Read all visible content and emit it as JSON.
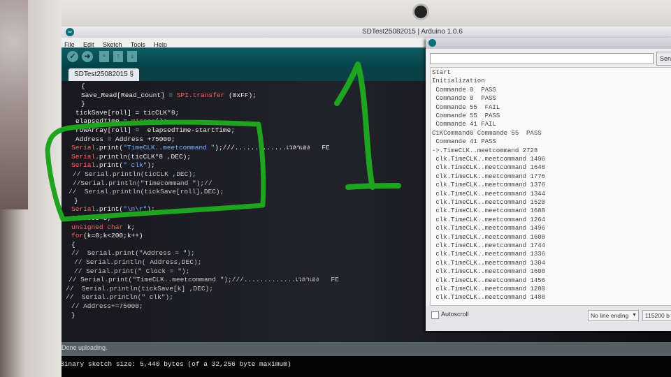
{
  "ide": {
    "title": "SDTest25082015 | Arduino 1.0.6",
    "menu": [
      "File",
      "Edit",
      "Sketch",
      "Tools",
      "Help"
    ],
    "toolbar": {
      "verify": "✓",
      "upload": "➜",
      "new": "▫",
      "open": "↑",
      "save": "↓"
    },
    "tab_label": "SDTest25082015 §",
    "code_lines": [
      "  {",
      "    Save_Read[Read_count] = SPI.transfer (0xFF);",
      "  }",
      "  tickSave[roll] = ticCLK*8;",
      "  elapsedTime = micros();",
      "  rowArray[roll] =  elapsedTime-startTime;",
      "  Address = Address +75000;",
      " Serial.print(\"TimeCLK..meetcommand \");///.............เวลาเอง   FE",
      " Serial.println(ticCLK*8 ,DEC);",
      " Serial.print(\" clk\");",
      "  // Serial.println(ticCLK ,DEC);",
      "  //Serial.println(\"Timecommand \");//",
      "//  Serial.println(tickSave[roll],DEC);",
      " }",
      " Serial.print(\"\\n\\r\");",
      " Address=0;",
      " unsigned char k;",
      " for(k=0;k<200;k++)",
      " {",
      " //  Serial.print(\"Address = \");",
      "  // Serial.println( Address,DEC);",
      "  // Serial.print(\" Clock = \");",
      "// Serial.print(\"TimeCLK..meetcommand \");///.............เวลาเอง   FE",
      "//  Serial.println(tickSave[k] ,DEC);",
      "//  Serial.println(\" clk\");",
      "  // Address+=75000;",
      " }"
    ],
    "status": "Done uploading.",
    "console": "Binary sketch size: 5,440 bytes (of a 32,256 byte maximum)"
  },
  "serial_monitor": {
    "send_label": "Send",
    "output_lines": [
      "Start",
      "Initialization",
      " Commande 0  PASS",
      " Commande 8  PASS",
      " Commande 55  FAIL",
      " Commande 55  PASS",
      " Commande 41 FAIL",
      "C1KCommand0 Commande 55  PASS",
      " Commande 41 PASS",
      "->.TimeCLK..meetcommand 2728",
      " clk.TimeCLK..meetcommand 1496",
      " clk.TimeCLK..meetcommand 1648",
      " clk.TimeCLK..meetcommand 1776",
      " clk.TimeCLK..meetcommand 1376",
      " clk.TimeCLK..meetcommand 1344",
      " clk.TimeCLK..meetcommand 1520",
      " clk.TimeCLK..meetcommand 1688",
      " clk.TimeCLK..meetcommand 1264",
      " clk.TimeCLK..meetcommand 1496",
      " clk.TimeCLK..meetcommand 1608",
      " clk.TimeCLK..meetcommand 1744",
      " clk.TimeCLK..meetcommand 1336",
      " clk.TimeCLK..meetcommand 1304",
      " clk.TimeCLK..meetcommand 1608",
      " clk.TimeCLK..meetcommand 1456",
      " clk.TimeCLK..meetcommand 1280",
      " clk.TimeCLK..meetcommand 1488"
    ],
    "autoscroll_label": "Autoscroll",
    "line_ending": "No line ending",
    "baud": "115200 b"
  },
  "annotation_text": "1",
  "colors": {
    "annotation": "#1fa41f",
    "toolbar": "#0e5d63",
    "editor_bg": "#1a1a20"
  }
}
